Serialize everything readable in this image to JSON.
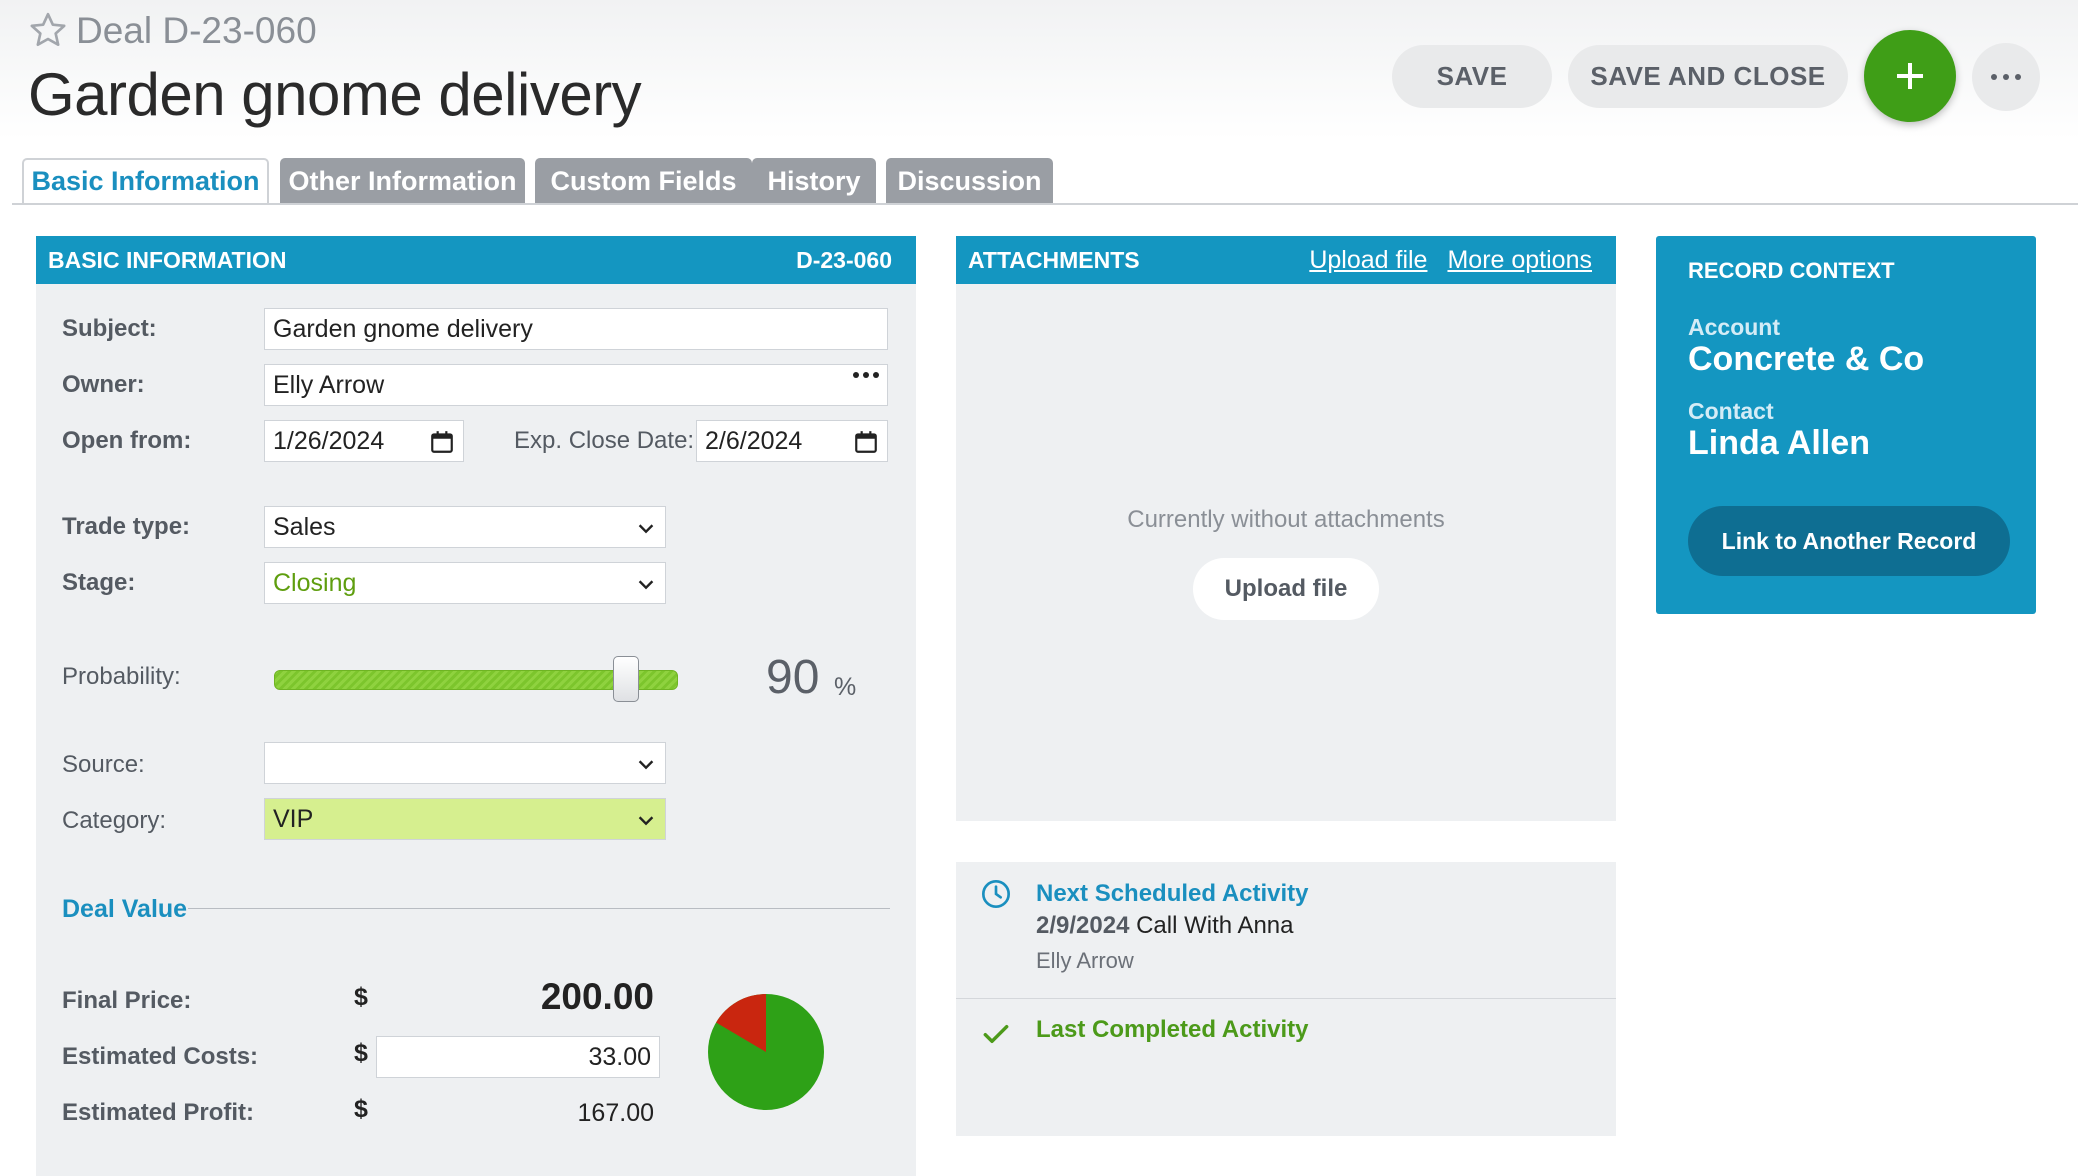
{
  "header": {
    "deal_prefix": "Deal",
    "deal_id": "D-23-060",
    "title": "Garden gnome delivery",
    "save_label": "SAVE",
    "save_close_label": "SAVE AND CLOSE"
  },
  "tabs": [
    {
      "label": "Basic Information",
      "active": true
    },
    {
      "label": "Other Information"
    },
    {
      "label": "Custom Fields"
    },
    {
      "label": "History"
    },
    {
      "label": "Discussion"
    }
  ],
  "basic_info": {
    "heading": "BASIC INFORMATION",
    "record_id": "D-23-060",
    "subject_label": "Subject:",
    "subject_value": "Garden gnome delivery",
    "owner_label": "Owner:",
    "owner_value": "Elly Arrow",
    "open_from_label": "Open from:",
    "open_from_value": "1/26/2024",
    "exp_close_label": "Exp. Close Date:",
    "exp_close_value": "2/6/2024",
    "trade_type_label": "Trade type:",
    "trade_type_value": "Sales",
    "stage_label": "Stage:",
    "stage_value": "Closing",
    "probability_label": "Probability:",
    "probability_value": "90",
    "probability_unit": "%",
    "probability_fraction": 0.9,
    "source_label": "Source:",
    "source_value": "",
    "category_label": "Category:",
    "category_value": "VIP"
  },
  "deal_value": {
    "heading": "Deal Value",
    "currency": "$",
    "final_price_label": "Final Price:",
    "final_price": "200.00",
    "est_costs_label": "Estimated Costs:",
    "est_costs": "33.00",
    "est_profit_label": "Estimated Profit:",
    "est_profit": "167.00",
    "profit_share": 0.835
  },
  "attachments": {
    "heading": "ATTACHMENTS",
    "upload_link": "Upload file",
    "more_link": "More options",
    "empty_text": "Currently without attachments",
    "upload_button": "Upload file"
  },
  "activities": {
    "next_title": "Next Scheduled Activity",
    "next_date": "2/9/2024",
    "next_name": "Call With Anna",
    "next_owner": "Elly Arrow",
    "last_title": "Last Completed Activity"
  },
  "context": {
    "heading": "RECORD CONTEXT",
    "account_label": "Account",
    "account_value": "Concrete & Co",
    "contact_label": "Contact",
    "contact_value": "Linda Allen",
    "link_button": "Link to Another Record"
  },
  "colors": {
    "accent": "#1496c1",
    "add_button": "#3f9e17",
    "stage_text": "#5f9e0f",
    "category_bg": "#d6ef8f",
    "pie_profit": "#2ea117",
    "pie_cost": "#c9260f",
    "activity_next": "#1a8fbf",
    "activity_done": "#4c9a1a"
  },
  "icons": {
    "star": "star-icon",
    "add": "plus-icon",
    "more": "ellipsis-icon",
    "calendar": "calendar-icon",
    "dropdown": "chevron-down-icon",
    "clock": "clock-icon",
    "check": "check-icon"
  }
}
